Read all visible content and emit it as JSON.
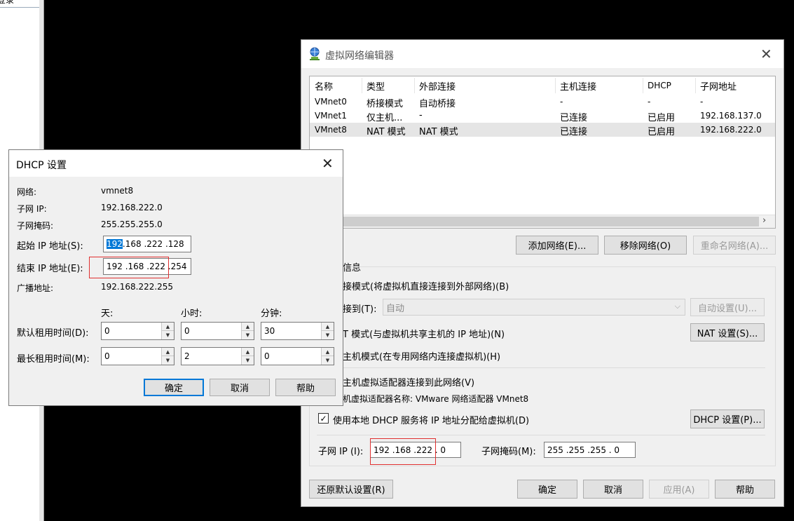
{
  "background": {
    "top_left_text": "登录"
  },
  "vne": {
    "title": "虚拟网络编辑器",
    "columns": [
      "名称",
      "类型",
      "外部连接",
      "主机连接",
      "DHCP",
      "子网地址"
    ],
    "rows": [
      [
        "VMnet0",
        "桥接模式",
        "自动桥接",
        "-",
        "-",
        "-"
      ],
      [
        "VMnet1",
        "仅主机...",
        "-",
        "已连接",
        "已启用",
        "192.168.137.0"
      ],
      [
        "VMnet8",
        "NAT 模式",
        "NAT 模式",
        "已连接",
        "已启用",
        "192.168.222.0"
      ]
    ],
    "add_network": "添加网络(E)...",
    "remove_network": "移除网络(O)",
    "rename_network": "重命名网络(A)...",
    "info_label": "信息",
    "bridged_text": "接模式(将虚拟机直接连接到外部网络)(B)",
    "bridged_to_label": "接到(T):",
    "bridged_select": "自动",
    "auto_settings": "自动设置(U)...",
    "nat_text": "T 模式(与虚拟机共享主机的 IP 地址)(N)",
    "nat_settings": "NAT 设置(S)...",
    "hostonly_text": "主机模式(在专用网络内连接虚拟机)(H)",
    "connect_adapter_text": "主机虚拟适配器连接到此网络(V)",
    "adapter_name_text": "机虚拟适配器名称: VMware 网络适配器 VMnet8",
    "dhcp_checkbox_text": "使用本地 DHCP 服务将 IP 地址分配给虚拟机(D)",
    "dhcp_settings": "DHCP 设置(P)...",
    "subnet_ip_label": "子网 IP (I):",
    "subnet_ip_value": "192 .168 .222 .  0",
    "subnet_mask_label": "子网掩码(M):",
    "subnet_mask_value": "255 .255 .255 .  0",
    "restore_defaults": "还原默认设置(R)",
    "ok": "确定",
    "cancel": "取消",
    "apply": "应用(A)",
    "help": "帮助"
  },
  "dhcp": {
    "title": "DHCP 设置",
    "network_label": "网络:",
    "network_value": "vmnet8",
    "subnet_ip_label": "子网 IP:",
    "subnet_ip_value": "192.168.222.0",
    "subnet_mask_label": "子网掩码:",
    "subnet_mask_value": "255.255.255.0",
    "start_ip_label": "起始 IP 地址(S):",
    "start_ip_selected": "192",
    "start_ip_rest": " .168 .222 .128",
    "end_ip_label": "结束 IP 地址(E):",
    "end_ip_value": "192 .168 .222 .254",
    "broadcast_label": "广播地址:",
    "broadcast_value": "192.168.222.255",
    "day_label": "天:",
    "hour_label": "小时:",
    "minute_label": "分钟:",
    "default_lease_label": "默认租用时间(D):",
    "default_lease": [
      "0",
      "0",
      "30"
    ],
    "max_lease_label": "最长租用时间(M):",
    "max_lease": [
      "0",
      "2",
      "0"
    ],
    "ok": "确定",
    "cancel": "取消",
    "help": "帮助"
  },
  "colors": {
    "selection": "#0078d7",
    "highlight_box": "#e03030"
  }
}
